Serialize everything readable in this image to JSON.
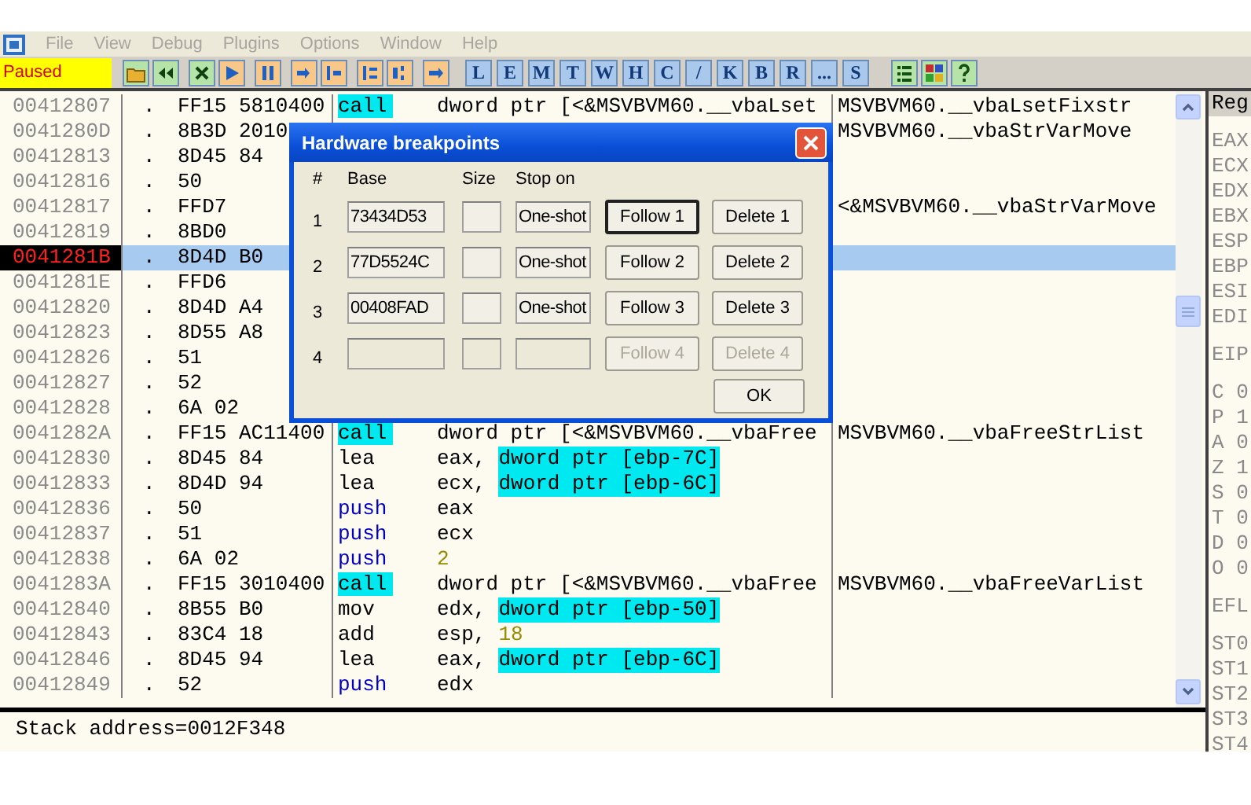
{
  "menu": [
    "File",
    "View",
    "Debug",
    "Plugins",
    "Options",
    "Window",
    "Help"
  ],
  "status": "Paused",
  "letters": [
    "L",
    "E",
    "M",
    "T",
    "W",
    "H",
    "C",
    "/",
    "K",
    "B",
    "R",
    "...",
    "S"
  ],
  "marker": ".",
  "rows": [
    {
      "address": "00412807",
      "hex": "FF15 5810400",
      "mnemonic": "call",
      "kind": "call",
      "operand": [
        {
          "kind": "plain",
          "text": "dword ptr [<&MSVBVM60.__vbaLset"
        }
      ],
      "comment": "MSVBVM60.__vbaLsetFixstr",
      "selected": false
    },
    {
      "address": "0041280D",
      "hex": "8B3D 2010",
      "comment": "MSVBVM60.__vbaStrVarMove",
      "selected": false
    },
    {
      "address": "00412813",
      "hex": "8D45 84",
      "selected": false
    },
    {
      "address": "00412816",
      "hex": "50",
      "selected": false
    },
    {
      "address": "00412817",
      "hex": "FFD7",
      "comment": "<&MSVBVM60.__vbaStrVarMove",
      "selected": false
    },
    {
      "address": "00412819",
      "hex": "8BD0",
      "selected": false
    },
    {
      "address": "0041281B",
      "hex": "8D4D B0",
      "selected": true
    },
    {
      "address": "0041281E",
      "hex": "FFD6",
      "selected": false
    },
    {
      "address": "00412820",
      "hex": "8D4D A4",
      "selected": false
    },
    {
      "address": "00412823",
      "hex": "8D55 A8",
      "selected": false
    },
    {
      "address": "00412826",
      "hex": "51",
      "selected": false
    },
    {
      "address": "00412827",
      "hex": "52",
      "selected": false
    },
    {
      "address": "00412828",
      "hex": "6A 02",
      "selected": false
    },
    {
      "address": "0041282A",
      "hex": "FF15 AC11400",
      "mnemonic": "call",
      "kind": "call",
      "operand": [
        {
          "kind": "plain",
          "text": "dword ptr [<&MSVBVM60.__vbaFree"
        }
      ],
      "comment": "MSVBVM60.__vbaFreeStrList",
      "selected": false
    },
    {
      "address": "00412830",
      "hex": "8D45 84",
      "mnemonic": "lea",
      "kind": "plain",
      "operand": [
        {
          "kind": "plain",
          "text": "eax,"
        },
        {
          "kind": "mem",
          "text": "dword ptr [ebp-7C]"
        }
      ],
      "selected": false
    },
    {
      "address": "00412833",
      "hex": "8D4D 94",
      "mnemonic": "lea",
      "kind": "plain",
      "operand": [
        {
          "kind": "plain",
          "text": "ecx,"
        },
        {
          "kind": "mem",
          "text": "dword ptr [ebp-6C]"
        }
      ],
      "selected": false
    },
    {
      "address": "00412836",
      "hex": "50",
      "mnemonic": "push",
      "kind": "push",
      "operand": [
        {
          "kind": "plain",
          "text": "eax"
        }
      ],
      "selected": false
    },
    {
      "address": "00412837",
      "hex": "51",
      "mnemonic": "push",
      "kind": "push",
      "operand": [
        {
          "kind": "plain",
          "text": "ecx"
        }
      ],
      "selected": false
    },
    {
      "address": "00412838",
      "hex": "6A 02",
      "mnemonic": "push",
      "kind": "push",
      "operand": [
        {
          "kind": "const",
          "text": "2"
        }
      ],
      "selected": false
    },
    {
      "address": "0041283A",
      "hex": "FF15 3010400",
      "mnemonic": "call",
      "kind": "call",
      "operand": [
        {
          "kind": "plain",
          "text": "dword ptr [<&MSVBVM60.__vbaFree"
        }
      ],
      "comment": "MSVBVM60.__vbaFreeVarList",
      "selected": false
    },
    {
      "address": "00412840",
      "hex": "8B55 B0",
      "mnemonic": "mov",
      "kind": "plain",
      "operand": [
        {
          "kind": "plain",
          "text": "edx,"
        },
        {
          "kind": "mem",
          "text": "dword ptr [ebp-50]"
        }
      ],
      "selected": false
    },
    {
      "address": "00412843",
      "hex": "83C4 18",
      "mnemonic": "add",
      "kind": "plain",
      "operand": [
        {
          "kind": "plain",
          "text": "esp,"
        },
        {
          "kind": "const",
          "text": "18"
        }
      ],
      "selected": false
    },
    {
      "address": "00412846",
      "hex": "8D45 94",
      "mnemonic": "lea",
      "kind": "plain",
      "operand": [
        {
          "kind": "plain",
          "text": "eax,"
        },
        {
          "kind": "mem",
          "text": "dword ptr [ebp-6C]"
        }
      ],
      "selected": false
    },
    {
      "address": "00412849",
      "hex": "52",
      "mnemonic": "push",
      "kind": "push",
      "operand": [
        {
          "kind": "plain",
          "text": "edx"
        }
      ],
      "selected": false
    }
  ],
  "info": "Stack address=0012F348",
  "registers": [
    [
      "Reg"
    ],
    [
      "EAX",
      "ECX",
      "EDX",
      "EBX",
      "ESP",
      "EBP",
      "ESI",
      "EDI"
    ],
    [
      "EIP"
    ],
    [
      "C 0",
      "P 1",
      "A 0",
      "Z 1",
      "S 0",
      "T 0",
      "D 0",
      "O 0"
    ],
    [
      "EFL"
    ],
    [
      "ST0",
      "ST1",
      "ST2",
      "ST3",
      "ST4"
    ]
  ],
  "dialog": {
    "title": "Hardware breakpoints",
    "headers": [
      "#",
      "Base",
      "Size",
      "Stop on"
    ],
    "breakpoints": [
      {
        "number": "1",
        "base": "73434D53",
        "stop_on": "One-shot",
        "follow": "Follow 1",
        "delete": "Delete 1",
        "disabled": false,
        "focused": true
      },
      {
        "number": "2",
        "base": "77D5524C",
        "stop_on": "One-shot",
        "follow": "Follow 2",
        "delete": "Delete 2",
        "disabled": false,
        "focused": false
      },
      {
        "number": "3",
        "base": "00408FAD",
        "stop_on": "One-shot",
        "follow": "Follow 3",
        "delete": "Delete 3",
        "disabled": false,
        "focused": false
      },
      {
        "number": "4",
        "follow": "Follow 4",
        "delete": "Delete 4",
        "disabled": true,
        "focused": false
      }
    ],
    "ok": "OK"
  }
}
